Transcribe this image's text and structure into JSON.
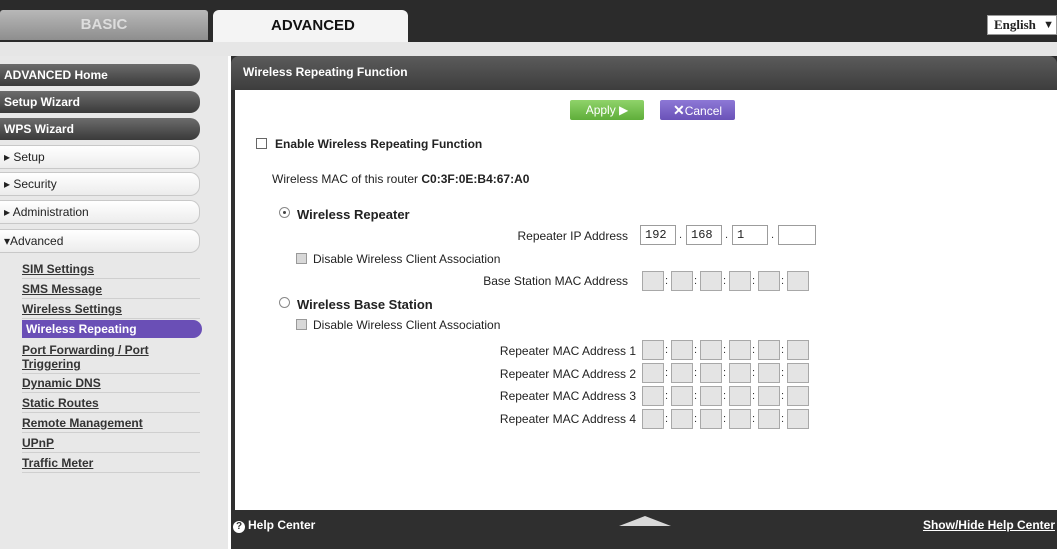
{
  "tabs": {
    "basic": "BASIC",
    "advanced": "ADVANCED"
  },
  "language": {
    "value": "English",
    "arrow": "▼"
  },
  "sidebar": {
    "home": "ADVANCED Home",
    "setup_wizard": "Setup Wizard",
    "wps_wizard": "WPS Wizard",
    "setup": "▸ Setup",
    "security": "▸ Security",
    "administration": "▸ Administration",
    "advanced": "▾Advanced",
    "sub_items": [
      "SIM Settings",
      "SMS Message",
      "Wireless Settings",
      "Wireless Repeating",
      "Port Forwarding / Port",
      "Triggering",
      "Dynamic DNS",
      "Static Routes",
      "Remote Management",
      "UPnP",
      "Traffic Meter"
    ]
  },
  "panel": {
    "title": "Wireless Repeating Function",
    "apply_label": "Apply ▶",
    "cancel_label": "Cancel",
    "enable_label": "Enable Wireless Repeating Function",
    "mac_text": "Wireless MAC of this router",
    "mac_value": "C0:3F:0E:B4:67:A0",
    "repeater_label": "Wireless Repeater",
    "repeater_ip_label": "Repeater IP Address",
    "ip": [
      "192",
      "168",
      "1",
      ""
    ],
    "disable_assoc_label": "Disable Wireless Client Association",
    "base_mac_label": "Base Station MAC Address",
    "base_station_label": "Wireless Base Station",
    "repeater_mac_labels": [
      "Repeater MAC Address 1",
      "Repeater MAC Address 2",
      "Repeater MAC Address 3",
      "Repeater MAC Address 4"
    ]
  },
  "footer": {
    "help": "Help Center",
    "toggle": "Show/Hide Help Center"
  },
  "colors": {
    "accent": "#6a4fb6",
    "apply": "#6fbf48",
    "dark": "#2f2f2f"
  }
}
